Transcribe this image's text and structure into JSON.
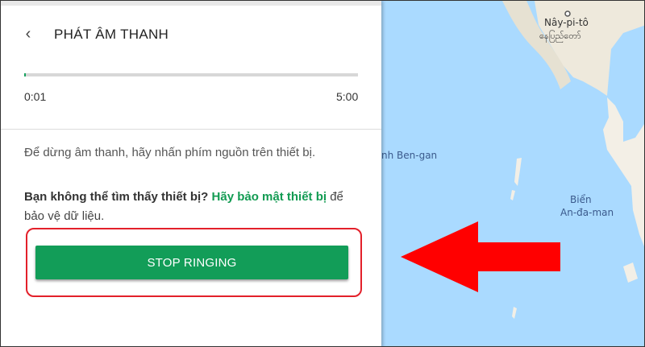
{
  "panel": {
    "title": "PHÁT ÂM THANH",
    "back_glyph": "‹",
    "progress": {
      "current_time": "0:01",
      "end_time": "5:00",
      "fraction": 0.0033
    },
    "hint": "Để dừng âm thanh, hãy nhấn phím nguồn trên thiết bị.",
    "cant_find": {
      "question": "Bạn không thể tìm thấy thiết bị?",
      "link": "Hãy bảo mật thiết bị",
      "rest": "để bảo vệ dữ liệu."
    },
    "stop_button": "STOP RINGING"
  },
  "map": {
    "city_name": "Nây-pi-tô",
    "city_name_local": "နေပြည်တော်",
    "bay_label": "nh Ben-gan",
    "sea_label_1": "Biển",
    "sea_label_2": "An-đa-man"
  },
  "colors": {
    "accent_green": "#129d58",
    "highlight_red": "#e3202a",
    "water": "#aadaff",
    "land": "#f3efe6"
  },
  "icons": [
    "back-arrow-icon",
    "red-pointer-arrow-icon",
    "city-marker-icon"
  ]
}
